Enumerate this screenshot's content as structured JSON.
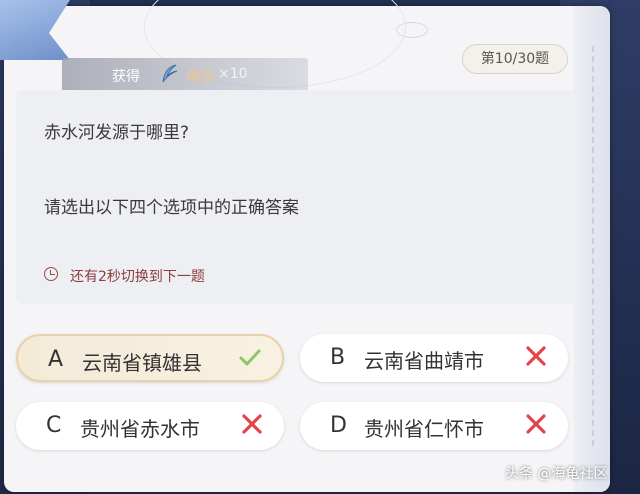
{
  "reward": {
    "label": "获得",
    "item": "瑞羽",
    "count": "×10"
  },
  "progress": {
    "counter": "第10/30题"
  },
  "question": {
    "text": "赤水河发源于哪里?",
    "hint": "请选出以下四个选项中的正确答案",
    "timer": "还有2秒切换到下一题"
  },
  "options": [
    {
      "letter": "A",
      "text": "云南省镇雄县",
      "status": "correct"
    },
    {
      "letter": "B",
      "text": "云南省曲靖市",
      "status": "wrong"
    },
    {
      "letter": "C",
      "text": "贵州省赤水市",
      "status": "wrong"
    },
    {
      "letter": "D",
      "text": "贵州省仁怀市",
      "status": "wrong"
    }
  ],
  "watermark": "头条 @海龟社区",
  "colors": {
    "correct": "#8fc46a",
    "wrong": "#e4444b",
    "accent": "#f0c58a"
  }
}
